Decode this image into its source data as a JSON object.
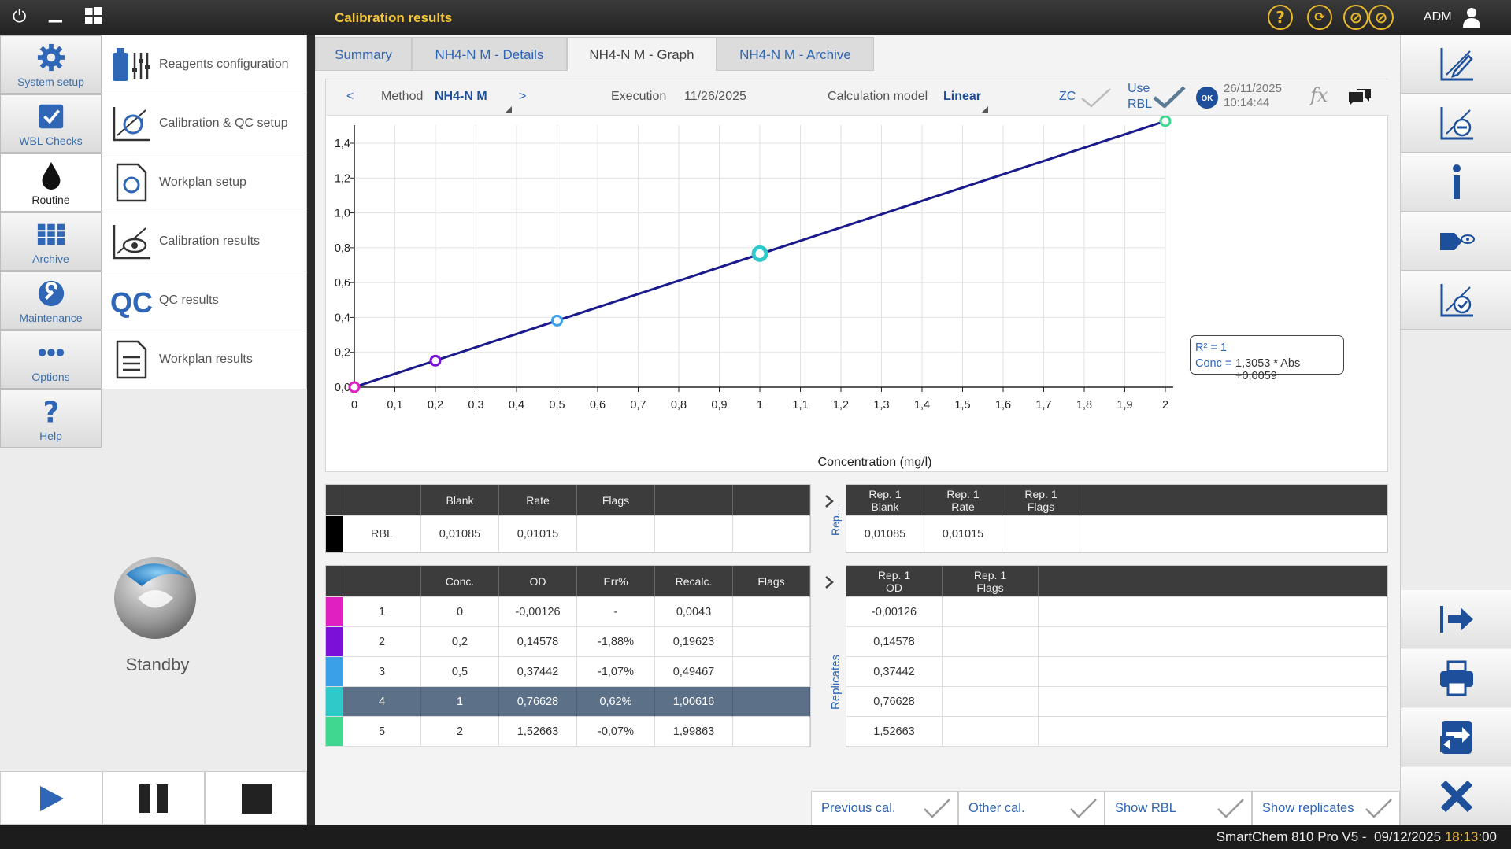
{
  "window": {
    "title": "Calibration results",
    "user": "ADM"
  },
  "left_nav": [
    {
      "label": "System setup",
      "icon": "gear-icon"
    },
    {
      "label": "WBL Checks",
      "icon": "checkbox-icon"
    },
    {
      "label": "Routine",
      "icon": "drop-icon"
    },
    {
      "label": "Archive",
      "icon": "archive-icon"
    },
    {
      "label": "Maintenance",
      "icon": "wrench-icon"
    },
    {
      "label": "Options",
      "icon": "dots-icon"
    },
    {
      "label": "Help",
      "icon": "question-icon"
    }
  ],
  "submenu": [
    {
      "label": "Reagents configuration",
      "icon": "reagents-icon"
    },
    {
      "label": "Calibration & QC setup",
      "icon": "calibration-setup-icon"
    },
    {
      "label": "Workplan setup",
      "icon": "workplan-setup-icon"
    },
    {
      "label": "Calibration results",
      "icon": "calibration-results-icon"
    },
    {
      "label": "QC results",
      "icon": "qc-icon"
    },
    {
      "label": "Workplan results",
      "icon": "workplan-results-icon"
    }
  ],
  "standby": {
    "label": "Standby"
  },
  "tabs": [
    "Summary",
    "NH4-N M - Details",
    "NH4-N M - Graph",
    "NH4-N M - Archive"
  ],
  "graph_header": {
    "prev": "<",
    "next": ">",
    "method_label": "Method",
    "method_value": "NH4-N M",
    "execution_label": "Execution",
    "execution_value": "11/26/2025",
    "calc_label": "Calculation model",
    "calc_value": "Linear",
    "zc_label": "ZC",
    "use_rbl_1": "Use",
    "use_rbl_2": "RBL",
    "ok_badge": "OK",
    "date": "26/11/2025",
    "time": "10:14:44",
    "fx": "fx"
  },
  "chart_data": {
    "type": "scatter",
    "xlabel": "Concentration (mg/l)",
    "ylabel": "",
    "xlim": [
      0,
      2
    ],
    "ylim": [
      0,
      1.55
    ],
    "xticks": [
      "0",
      "0,1",
      "0,2",
      "0,3",
      "0,4",
      "0,5",
      "0,6",
      "0,7",
      "0,8",
      "0,9",
      "1",
      "1,1",
      "1,2",
      "1,3",
      "1,4",
      "1,5",
      "1,6",
      "1,7",
      "1,8",
      "1,9",
      "2"
    ],
    "yticks": [
      "0,0",
      "0,2",
      "0,4",
      "0,6",
      "0,8",
      "1,0",
      "1,2",
      "1,4"
    ],
    "points": [
      {
        "x": 0,
        "y": 0,
        "color": "#e020c0"
      },
      {
        "x": 0.2,
        "y": 0.152,
        "color": "#7b10d8"
      },
      {
        "x": 0.5,
        "y": 0.382,
        "color": "#3aa0e8"
      },
      {
        "x": 1,
        "y": 0.766,
        "color": "#30c9c9",
        "selected": true
      },
      {
        "x": 2,
        "y": 1.527,
        "color": "#40d890"
      }
    ],
    "line": {
      "x": [
        0,
        2
      ],
      "y": [
        0,
        1.527
      ],
      "color": "#1a1a8c"
    },
    "grid": true,
    "annotation": {
      "r2": "R² = 1",
      "eq_label": "Conc =",
      "eq": "1,3053 * Abs +0,0059"
    }
  },
  "rbl_table": {
    "headers": [
      "",
      "Blank",
      "Rate",
      "Flags",
      "",
      ""
    ],
    "row": {
      "swatch": "#000000",
      "cells": [
        "RBL",
        "0,01085",
        "0,01015",
        "",
        "",
        ""
      ]
    }
  },
  "rbl_rep": {
    "side_label": "Rep...",
    "headers": [
      "Rep. 1\nBlank",
      "Rep. 1\nRate",
      "Rep. 1\nFlags",
      ""
    ],
    "row": [
      "0,01085",
      "0,01015",
      "",
      ""
    ]
  },
  "std_table": {
    "headers": [
      "",
      "Conc.",
      "OD",
      "Err%",
      "Recalc.",
      "Flags"
    ],
    "rows": [
      {
        "swatch": "#e020c0",
        "cells": [
          "1",
          "0",
          "-0,00126",
          "-",
          "0,0043",
          ""
        ]
      },
      {
        "swatch": "#7b10d8",
        "cells": [
          "2",
          "0,2",
          "0,14578",
          "-1,88%",
          "0,19623",
          ""
        ]
      },
      {
        "swatch": "#3aa0e8",
        "cells": [
          "3",
          "0,5",
          "0,37442",
          "-1,07%",
          "0,49467",
          ""
        ]
      },
      {
        "swatch": "#30c9c9",
        "cells": [
          "4",
          "1",
          "0,76628",
          "0,62%",
          "1,00616",
          ""
        ],
        "selected": true
      },
      {
        "swatch": "#40d890",
        "cells": [
          "5",
          "2",
          "1,52663",
          "-0,07%",
          "1,99863",
          ""
        ]
      }
    ]
  },
  "replicates": {
    "side_label": "Replicates",
    "headers": [
      "Rep. 1\nOD",
      "Rep. 1\nFlags",
      ""
    ],
    "rows": [
      [
        "-0,00126",
        "",
        ""
      ],
      [
        "0,14578",
        "",
        ""
      ],
      [
        "0,37442",
        "",
        ""
      ],
      [
        "0,76628",
        "",
        ""
      ],
      [
        "1,52663",
        "",
        ""
      ]
    ]
  },
  "bottom_buttons": [
    "Previous cal.",
    "Other cal.",
    "Show RBL",
    "Show replicates"
  ],
  "status": {
    "prefix": "SmartChem 810 Pro V5 -  09/12/2025 ",
    "time_hl": "18:13",
    "time_rest": ":00"
  }
}
